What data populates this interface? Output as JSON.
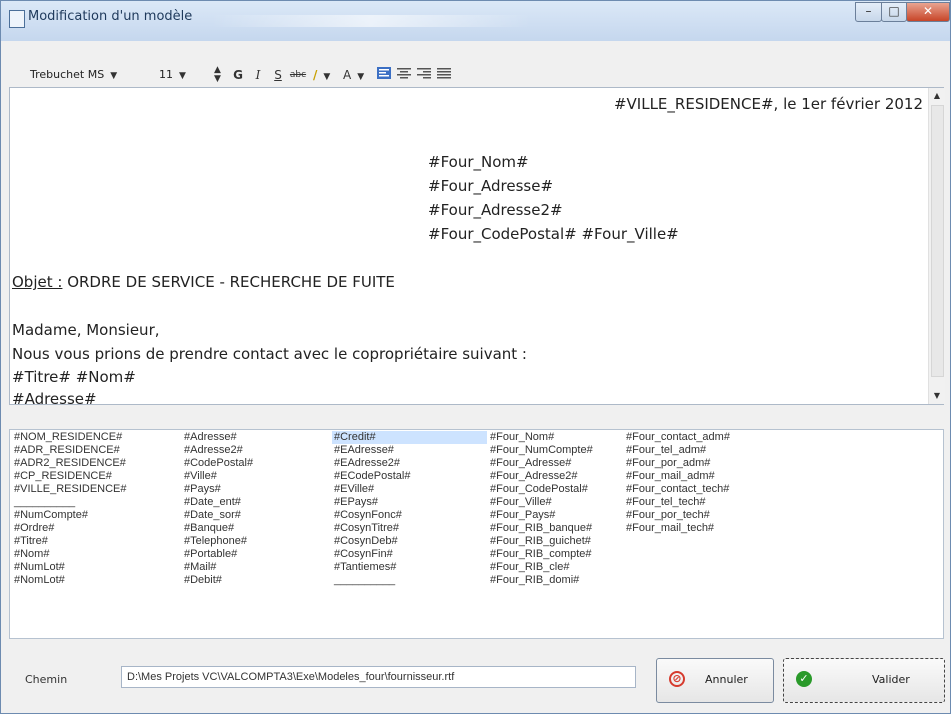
{
  "window": {
    "title": "Modification d'un modèle",
    "controls": {
      "minimize": "–",
      "maximize": "□",
      "close": "✕"
    }
  },
  "toolbar": {
    "font_name": "Trebuchet MS",
    "font_size": "11",
    "bold": "G",
    "italic": "I",
    "underline": "S",
    "strike": "abc",
    "text_color": "A"
  },
  "document": {
    "place_date": "#VILLE_RESIDENCE#, le 1er février 2012",
    "address_lines": [
      "#Four_Nom#",
      "#Four_Adresse#",
      "#Four_Adresse2#",
      "#Four_CodePostal# #Four_Ville#"
    ],
    "object_label": "Objet :",
    "object_text": " ORDRE DE SERVICE - RECHERCHE DE FUITE",
    "salutation": "Madame, Monsieur,",
    "body_line": "Nous vous prions de prendre contact avec le copropriétaire suivant :",
    "recipient_name": "#Titre# #Nom#",
    "recipient_address": "#Adresse#"
  },
  "fields": {
    "col1": [
      "#NOM_RESIDENCE#",
      "#ADR_RESIDENCE#",
      "#ADR2_RESIDENCE#",
      "#CP_RESIDENCE#",
      "#VILLE_RESIDENCE#",
      "__________",
      "#NumCompte#",
      "#Ordre#",
      "#Titre#",
      "#Nom#",
      "#NumLot#",
      "#NomLot#"
    ],
    "col2": [
      "#Adresse#",
      "#Adresse2#",
      "#CodePostal#",
      "#Ville#",
      "#Pays#",
      "#Date_ent#",
      "#Date_sor#",
      "#Banque#",
      "#Telephone#",
      "#Portable#",
      "#Mail#",
      "#Debit#"
    ],
    "col3": [
      "#Credit#",
      "#EAdresse#",
      "#EAdresse2#",
      "#ECodePostal#",
      "#EVille#",
      "#EPays#",
      "#CosynFonc#",
      "#CosynTitre#",
      "#CosynDeb#",
      "#CosynFin#",
      "#Tantiemes#",
      "__________"
    ],
    "col4": [
      "#Four_Nom#",
      "#Four_NumCompte#",
      "#Four_Adresse#",
      "#Four_Adresse2#",
      "#Four_CodePostal#",
      "#Four_Ville#",
      "#Four_Pays#",
      "#Four_RIB_banque#",
      "#Four_RIB_guichet#",
      "#Four_RIB_compte#",
      "#Four_RIB_cle#",
      "#Four_RIB_domi#"
    ],
    "col5": [
      "#Four_contact_adm#",
      "#Four_tel_adm#",
      "#Four_por_adm#",
      "#Four_mail_adm#",
      "#Four_contact_tech#",
      "#Four_tel_tech#",
      "#Four_por_tech#",
      "#Four_mail_tech#"
    ]
  },
  "footer": {
    "chemin_label": "Chemin",
    "path_value": "D:\\Mes Projets VC\\VALCOMPTA3\\Exe\\Modeles_four\\fournisseur.rtf",
    "annuler_label": "Annuler",
    "valider_label": "Valider"
  },
  "colors": {
    "selection": "#cde3ff",
    "title_bar": "#c5d7ee",
    "close": "#c74528",
    "valider_icon": "#2a9a2a",
    "annuler_icon": "#d63b2e"
  }
}
